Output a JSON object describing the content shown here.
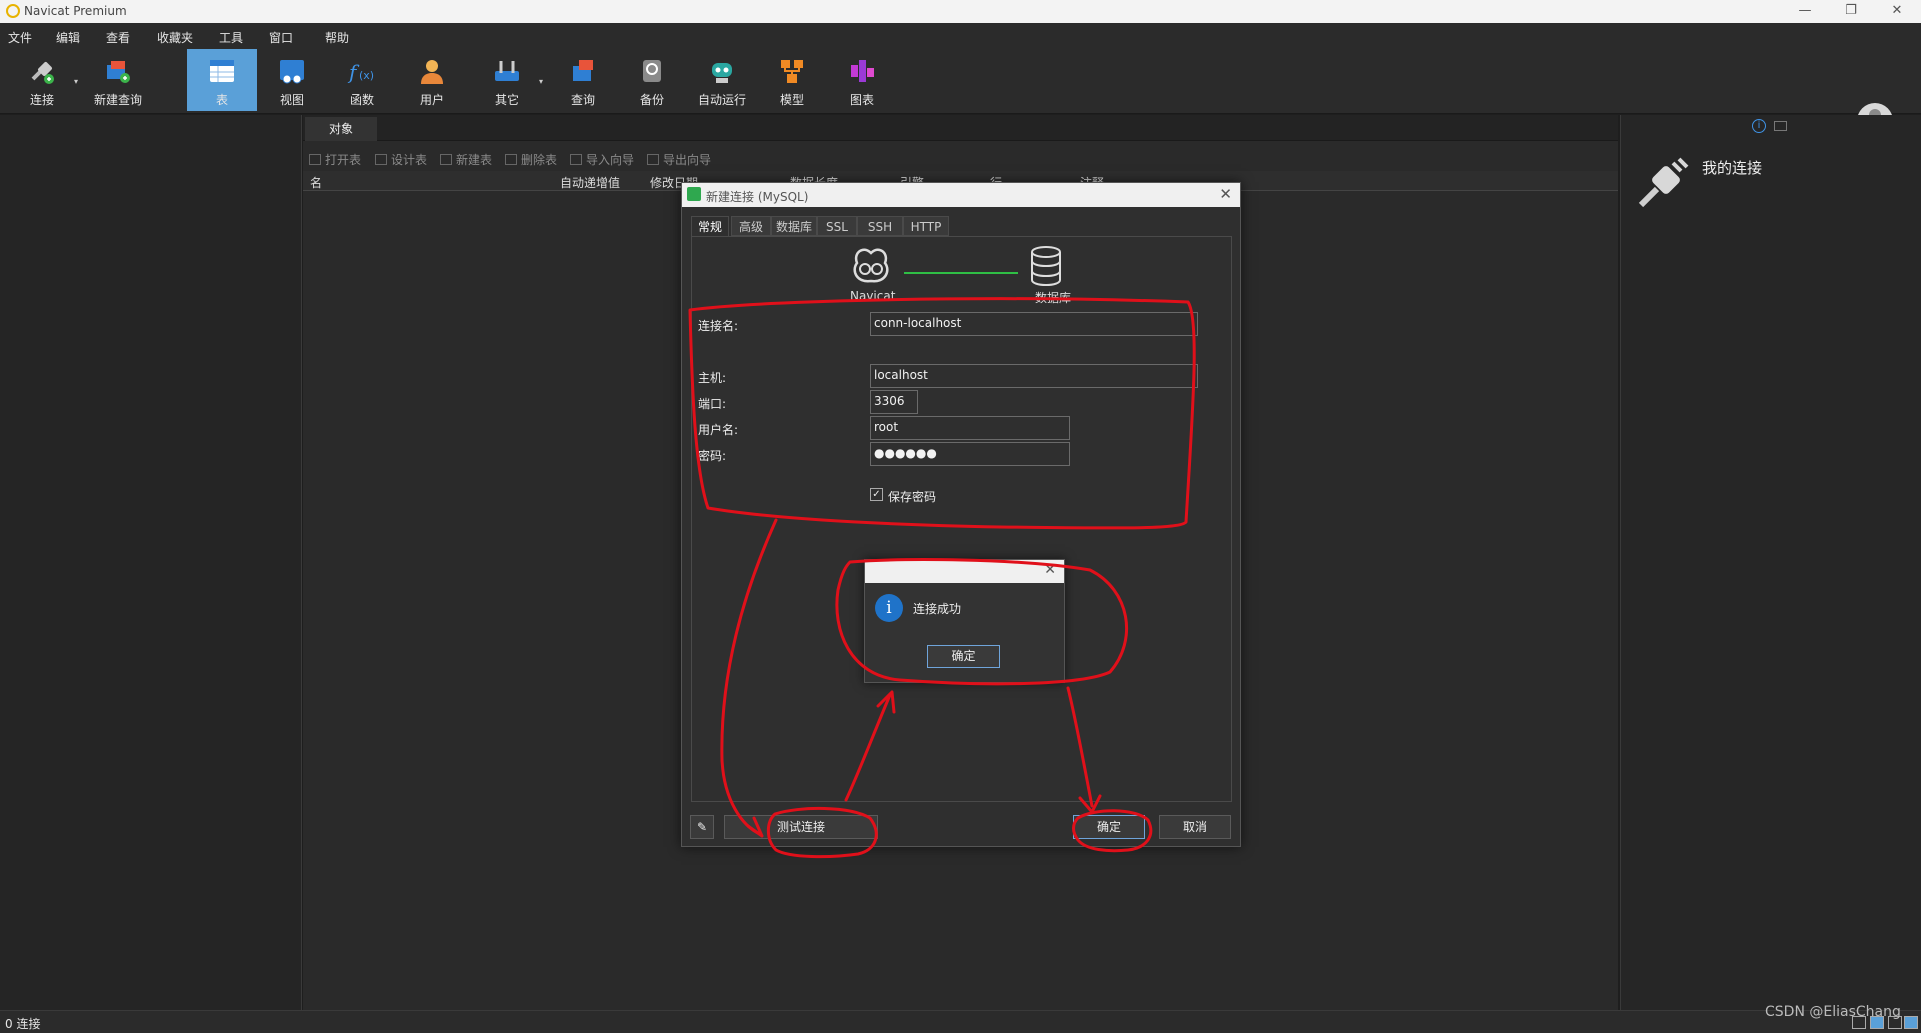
{
  "window": {
    "title": "Navicat Premium",
    "minimize": "—",
    "restore": "❐",
    "close": "✕"
  },
  "menu": [
    "文件",
    "编辑",
    "查看",
    "收藏夹",
    "工具",
    "窗口",
    "帮助"
  ],
  "toolbar": {
    "items": [
      {
        "label": "连接",
        "icon": "plug-icon"
      },
      {
        "label": "新建查询",
        "icon": "new-query-icon"
      },
      {
        "label": "表",
        "icon": "table-icon",
        "active": true
      },
      {
        "label": "视图",
        "icon": "view-icon"
      },
      {
        "label": "函数",
        "icon": "function-icon"
      },
      {
        "label": "用户",
        "icon": "user-icon"
      },
      {
        "label": "其它",
        "icon": "tools-icon"
      },
      {
        "label": "查询",
        "icon": "query-icon"
      },
      {
        "label": "备份",
        "icon": "backup-icon"
      },
      {
        "label": "自动运行",
        "icon": "robot-icon"
      },
      {
        "label": "模型",
        "icon": "model-icon"
      },
      {
        "label": "图表",
        "icon": "chart-icon"
      }
    ],
    "active_color": "#5aa0d8"
  },
  "objects": {
    "tab": "对象",
    "actions": [
      "打开表",
      "设计表",
      "新建表",
      "删除表",
      "导入向导",
      "导出向导"
    ],
    "columns": [
      "名",
      "自动递增值",
      "修改日期",
      "数据长度",
      "引擎",
      "行",
      "注释"
    ]
  },
  "right_panel": {
    "title": "我的连接"
  },
  "status": {
    "left": "0 连接"
  },
  "dialog": {
    "title": "新建连接 (MySQL)",
    "tabs": [
      "常规",
      "高级",
      "数据库",
      "SSL",
      "SSH",
      "HTTP"
    ],
    "navicat_label": "Navicat",
    "database_label": "数据库",
    "fields": {
      "conn_name_label": "连接名:",
      "conn_name_value": "conn-localhost",
      "host_label": "主机:",
      "host_value": "localhost",
      "port_label": "端口:",
      "port_value": "3306",
      "user_label": "用户名:",
      "user_value": "root",
      "password_label": "密码:",
      "password_value": "●●●●●●",
      "save_password_label": "保存密码",
      "save_password_checked": true
    },
    "test_button": "测试连接",
    "ok_button": "确定",
    "cancel_button": "取消"
  },
  "message": {
    "text": "连接成功",
    "ok": "确定"
  },
  "annotation_color": "#e0101a",
  "watermark": "CSDN @EliasChang"
}
